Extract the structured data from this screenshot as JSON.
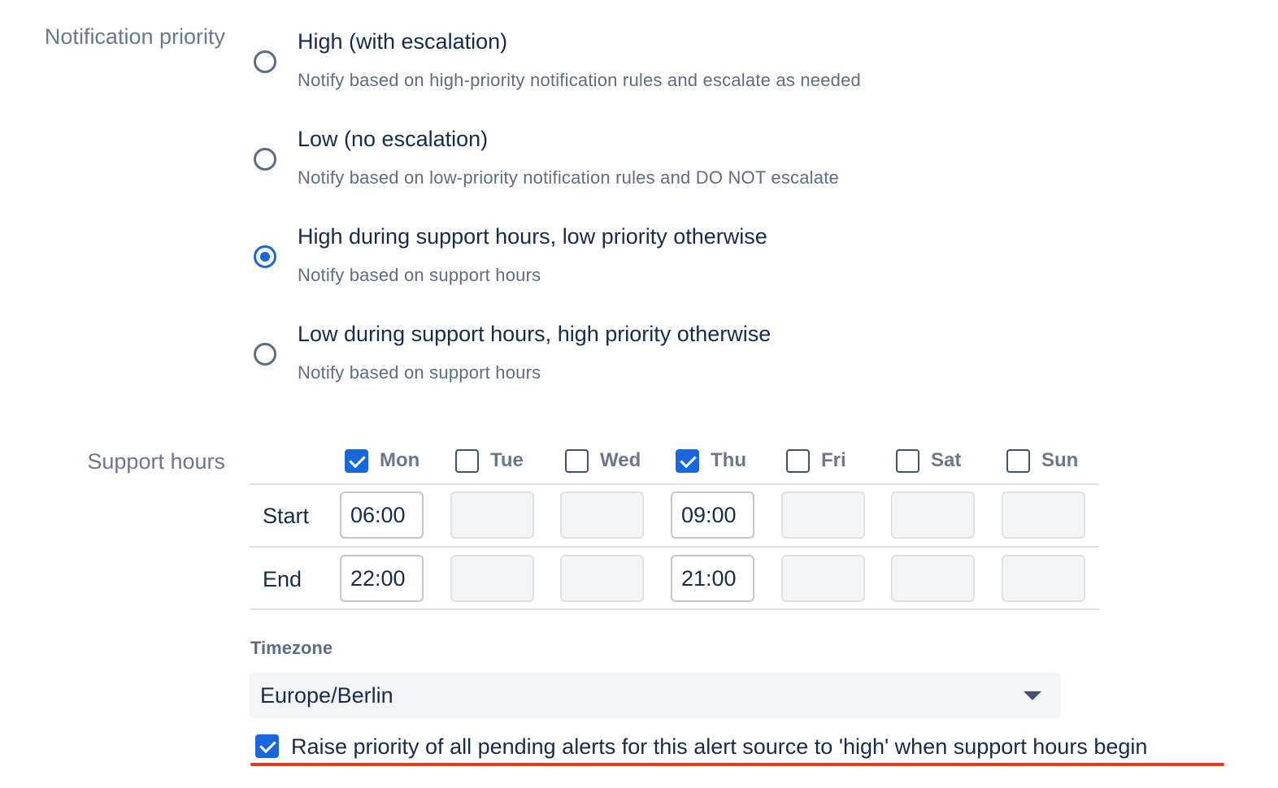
{
  "notification_priority": {
    "label": "Notification priority",
    "options": [
      {
        "title": "High (with escalation)",
        "description": "Notify based on high-priority notification rules and escalate as needed",
        "selected": false
      },
      {
        "title": "Low (no escalation)",
        "description": "Notify based on low-priority notification rules and DO NOT escalate",
        "selected": false
      },
      {
        "title": "High during support hours, low priority otherwise",
        "description": "Notify based on support hours",
        "selected": true
      },
      {
        "title": "Low during support hours, high priority otherwise",
        "description": "Notify based on support hours",
        "selected": false
      }
    ]
  },
  "support_hours": {
    "label": "Support hours",
    "start_label": "Start",
    "end_label": "End",
    "days": [
      {
        "name": "Mon",
        "checked": true,
        "start": "06:00",
        "end": "22:00"
      },
      {
        "name": "Tue",
        "checked": false,
        "start": "",
        "end": ""
      },
      {
        "name": "Wed",
        "checked": false,
        "start": "",
        "end": ""
      },
      {
        "name": "Thu",
        "checked": true,
        "start": "09:00",
        "end": "21:00"
      },
      {
        "name": "Fri",
        "checked": false,
        "start": "",
        "end": ""
      },
      {
        "name": "Sat",
        "checked": false,
        "start": "",
        "end": ""
      },
      {
        "name": "Sun",
        "checked": false,
        "start": "",
        "end": ""
      }
    ]
  },
  "timezone": {
    "label": "Timezone",
    "value": "Europe/Berlin"
  },
  "raise_priority": {
    "label": "Raise priority of all pending alerts for this alert source to 'high' when support hours begin",
    "checked": true
  },
  "colors": {
    "accent": "#1868db",
    "highlight_underline": "#e5391f"
  }
}
